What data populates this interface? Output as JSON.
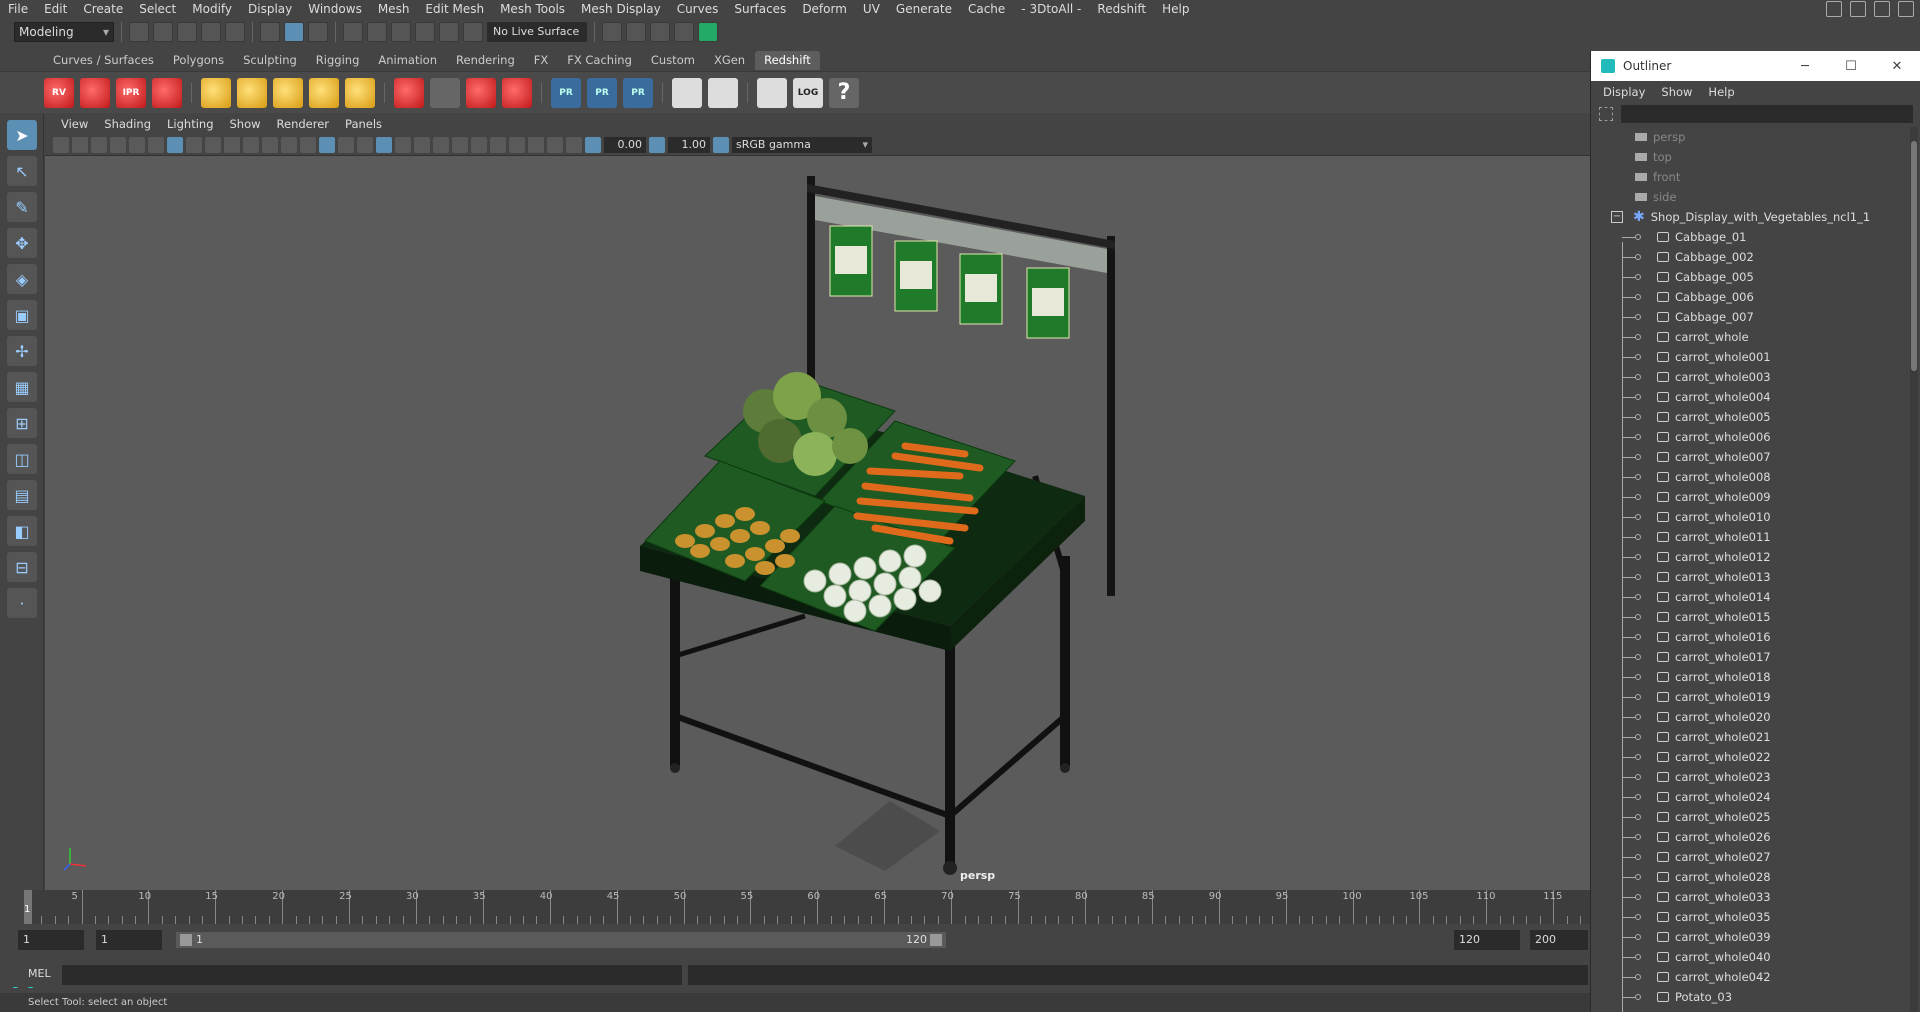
{
  "menu": [
    "File",
    "Edit",
    "Create",
    "Select",
    "Modify",
    "Display",
    "Windows",
    "Mesh",
    "Edit Mesh",
    "Mesh Tools",
    "Mesh Display",
    "Curves",
    "Surfaces",
    "Deform",
    "UV",
    "Generate",
    "Cache",
    "- 3DtoAll -",
    "Redshift",
    "Help"
  ],
  "status": {
    "mode": "Modeling",
    "live_surface": "No Live Surface"
  },
  "shelf_tabs": [
    "Curves / Surfaces",
    "Polygons",
    "Sculpting",
    "Rigging",
    "Animation",
    "Rendering",
    "FX",
    "FX Caching",
    "Custom",
    "XGen",
    "Redshift"
  ],
  "shelf_active": "Redshift",
  "shelf_labels": {
    "rv": "RV",
    "ipr": "IPR",
    "pr1": "PR",
    "pr2": "PR",
    "pr3": "PR",
    "help": "?",
    "log": "LOG"
  },
  "viewport": {
    "menu": [
      "View",
      "Shading",
      "Lighting",
      "Show",
      "Renderer",
      "Panels"
    ],
    "exposure": "0.00",
    "gamma_value": "1.00",
    "color_space": "sRGB gamma",
    "camera": "persp"
  },
  "timeline": {
    "current": "1",
    "ticks": [
      "5",
      "10",
      "15",
      "20",
      "25",
      "30",
      "35",
      "40",
      "45",
      "50",
      "55",
      "60",
      "65",
      "70",
      "75",
      "80",
      "85",
      "90",
      "95",
      "100",
      "105",
      "110",
      "115"
    ]
  },
  "range": {
    "start": "1",
    "anim_start": "1",
    "slider_start": "1",
    "slider_end": "120",
    "end": "120",
    "anim_end": "200"
  },
  "mel": {
    "label": "MEL"
  },
  "help_line": "Select Tool: select an object",
  "outliner": {
    "title": "Outliner",
    "menu": [
      "Display",
      "Show",
      "Help"
    ],
    "cameras": [
      "persp",
      "top",
      "front",
      "side"
    ],
    "group": "Shop_Display_with_Vegetables_ncl1_1",
    "items": [
      "Cabbage_01",
      "Cabbage_002",
      "Cabbage_005",
      "Cabbage_006",
      "Cabbage_007",
      "carrot_whole",
      "carrot_whole001",
      "carrot_whole003",
      "carrot_whole004",
      "carrot_whole005",
      "carrot_whole006",
      "carrot_whole007",
      "carrot_whole008",
      "carrot_whole009",
      "carrot_whole010",
      "carrot_whole011",
      "carrot_whole012",
      "carrot_whole013",
      "carrot_whole014",
      "carrot_whole015",
      "carrot_whole016",
      "carrot_whole017",
      "carrot_whole018",
      "carrot_whole019",
      "carrot_whole020",
      "carrot_whole021",
      "carrot_whole022",
      "carrot_whole023",
      "carrot_whole024",
      "carrot_whole025",
      "carrot_whole026",
      "carrot_whole027",
      "carrot_whole028",
      "carrot_whole033",
      "carrot_whole035",
      "carrot_whole039",
      "carrot_whole040",
      "carrot_whole042",
      "Potato_03"
    ]
  },
  "colors": {
    "accent": "#5b8fb3",
    "viewport_bg": "#5b5b5b",
    "crate_green": "#1e5a22",
    "carrot": "#e06a1c"
  }
}
